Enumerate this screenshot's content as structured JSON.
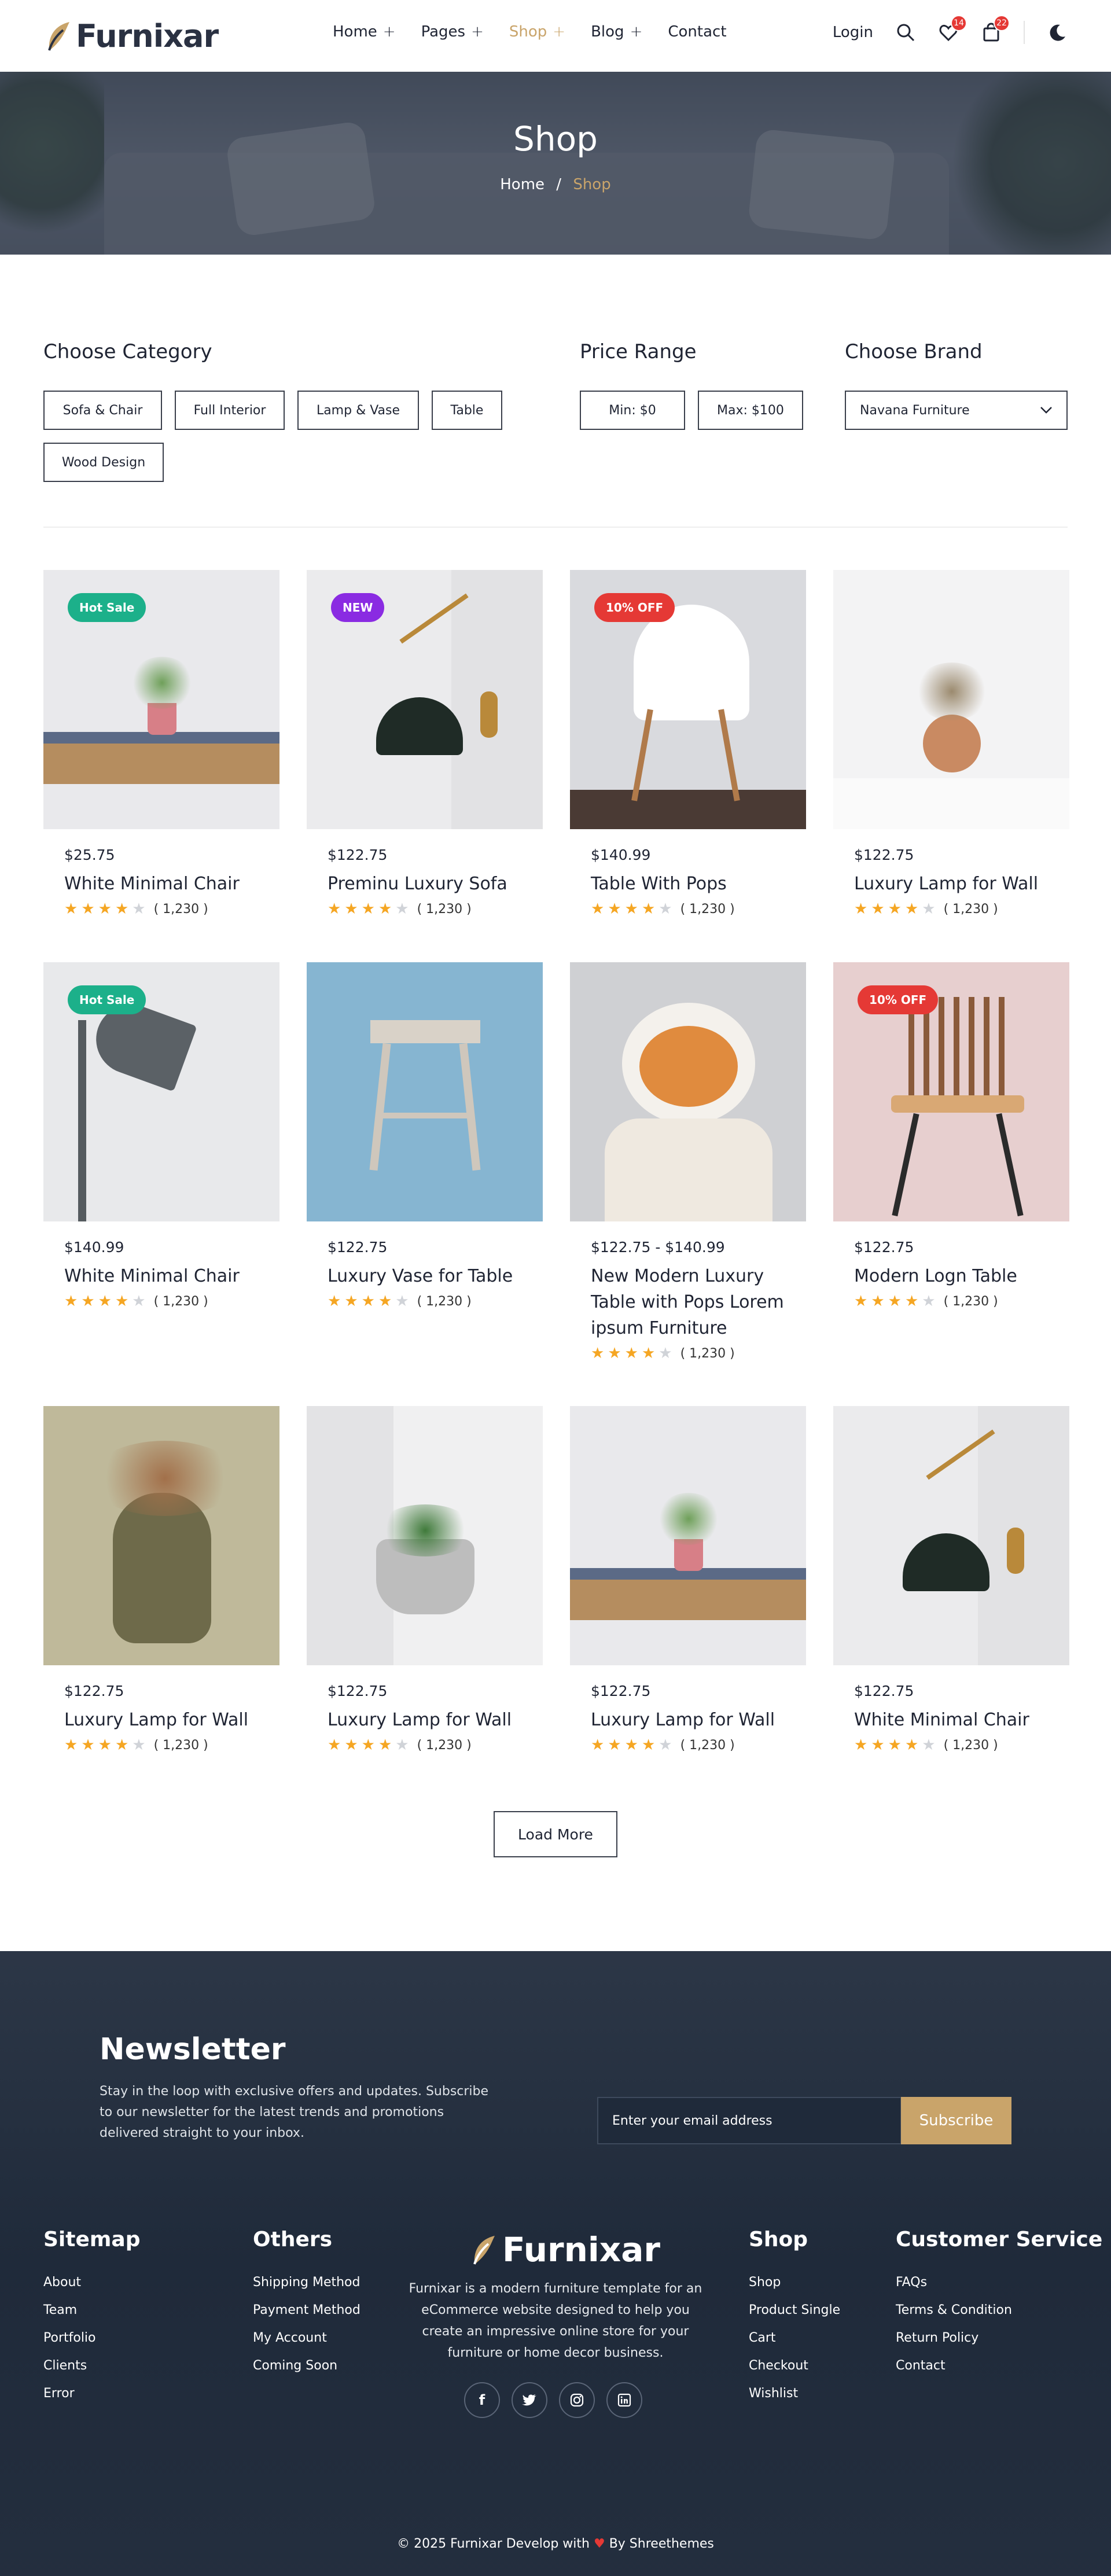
{
  "header": {
    "logo": "Furnixar",
    "nav": [
      {
        "label": "Home",
        "plus": "+"
      },
      {
        "label": "Pages",
        "plus": "+"
      },
      {
        "label": "Shop",
        "plus": "+"
      },
      {
        "label": "Blog",
        "plus": "+"
      },
      {
        "label": "Contact",
        "plus": ""
      }
    ],
    "login": "Login",
    "wishlist_count": "14",
    "cart_count": "22"
  },
  "hero": {
    "title": "Shop",
    "crumb_home": "Home",
    "crumb_sep": "/",
    "crumb_current": "Shop"
  },
  "filters": {
    "category_title": "Choose Category",
    "categories": [
      "Sofa & Chair",
      "Full Interior",
      "Lamp & Vase",
      "Table",
      "Wood Design"
    ],
    "price_title": "Price Range",
    "price_min": "Min: $0",
    "price_max": "Max: $100",
    "brand_title": "Choose Brand",
    "brand_selected": "Navana Furniture"
  },
  "products": [
    {
      "tag": "Hot Sale",
      "tag_color": "#1cb08a",
      "price": "$25.75",
      "name": "White Minimal Chair",
      "reviews": "( 1,230 )"
    },
    {
      "tag": "NEW",
      "tag_color": "#8a2be2",
      "price": "$122.75",
      "name": "Preminu Luxury Sofa",
      "reviews": "( 1,230 )"
    },
    {
      "tag": "10% OFF",
      "tag_color": "#e53935",
      "price": "$140.99",
      "name": "Table With Pops",
      "reviews": "( 1,230 )"
    },
    {
      "tag": "",
      "tag_color": "",
      "price": "$122.75",
      "name": "Luxury Lamp for Wall",
      "reviews": "( 1,230 )"
    },
    {
      "tag": "Hot Sale",
      "tag_color": "#1cb08a",
      "price": "$140.99",
      "name": "White Minimal Chair",
      "reviews": "( 1,230 )"
    },
    {
      "tag": "",
      "tag_color": "",
      "price": "$122.75",
      "name": "Luxury Vase for Table",
      "reviews": "( 1,230 )"
    },
    {
      "tag": "",
      "tag_color": "",
      "price": "$122.75 - $140.99",
      "name": "New Modern Luxury Table with Pops Lorem ipsum Furniture",
      "reviews": "( 1,230 )"
    },
    {
      "tag": "10% OFF",
      "tag_color": "#e53935",
      "price": "$122.75",
      "name": "Modern Logn Table",
      "reviews": "( 1,230 )"
    },
    {
      "tag": "",
      "tag_color": "",
      "price": "$122.75",
      "name": "Luxury Lamp for Wall",
      "reviews": "( 1,230 )"
    },
    {
      "tag": "",
      "tag_color": "",
      "price": "$122.75",
      "name": "Luxury Lamp for Wall",
      "reviews": "( 1,230 )"
    },
    {
      "tag": "",
      "tag_color": "",
      "price": "$122.75",
      "name": "Luxury Lamp for Wall",
      "reviews": "( 1,230 )"
    },
    {
      "tag": "",
      "tag_color": "",
      "price": "$122.75",
      "name": "White Minimal Chair",
      "reviews": "( 1,230 )"
    }
  ],
  "rating_stars": 4,
  "load_more": "Load More",
  "footer": {
    "newsletter_title": "Newsletter",
    "newsletter_text": "Stay in the loop with exclusive offers and updates. Subscribe to our newsletter for the latest trends and promotions delivered straight to your inbox.",
    "email_placeholder": "Enter your email address",
    "subscribe": "Subscribe",
    "sitemap_title": "Sitemap",
    "sitemap": [
      "About",
      "Team",
      "Portfolio",
      "Clients",
      "Error"
    ],
    "others_title": "Others",
    "others": [
      "Shipping Method",
      "Payment Method",
      "My Account",
      "Coming Soon"
    ],
    "logo": "Furnixar",
    "description": "Furnixar is a modern furniture template for an eCommerce website designed to help you create an impressive online store for your furniture or home decor business.",
    "shop_title": "Shop",
    "shop": [
      "Shop",
      "Product Single",
      "Cart",
      "Checkout",
      "Wishlist"
    ],
    "service_title": "Customer Service",
    "service": [
      "FAQs",
      "Terms & Condition",
      "Return Policy",
      "Contact"
    ],
    "social": [
      "facebook-icon",
      "twitter-icon",
      "instagram-icon",
      "linkedin-icon"
    ],
    "copyright_pre": "© 2025 Furnixar Develop with",
    "copyright_post": "By Shreethemes"
  },
  "colors": {
    "accent": "#c9a46a",
    "dark": "#1f2a3a",
    "star": "#f5a623"
  }
}
